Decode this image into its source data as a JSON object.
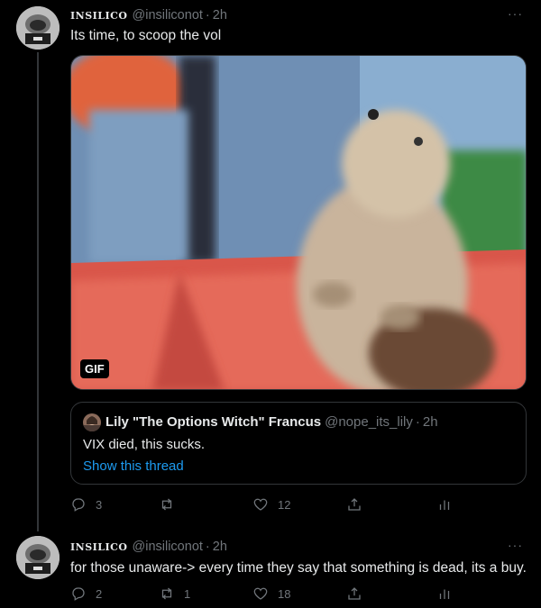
{
  "tweets": [
    {
      "name": "INSILICO",
      "handle": "@insiliconot",
      "separator": "·",
      "time": "2h",
      "more": "···",
      "text": "Its time, to scoop the vol",
      "media": {
        "badge": "GIF"
      },
      "quote": {
        "name": "Lily \"The Options Witch\" Francus",
        "handle": "@nope_its_lily",
        "separator": "·",
        "time": "2h",
        "text": "VIX died, this sucks.",
        "link": "Show this thread"
      },
      "actions": {
        "replies": "3",
        "retweets": "",
        "likes": "12"
      }
    },
    {
      "name": "INSILICO",
      "handle": "@insiliconot",
      "separator": "·",
      "time": "2h",
      "more": "···",
      "text": "for those unaware-> every time they say that something is dead, its a buy.",
      "actions": {
        "replies": "2",
        "retweets": "1",
        "likes": "18"
      }
    }
  ],
  "colors": {
    "background": "#000000",
    "link": "#1d9bf0",
    "muted": "#71767b"
  },
  "icons": [
    "reply-icon",
    "retweet-icon",
    "like-icon",
    "share-icon",
    "analytics-icon",
    "more-icon"
  ]
}
